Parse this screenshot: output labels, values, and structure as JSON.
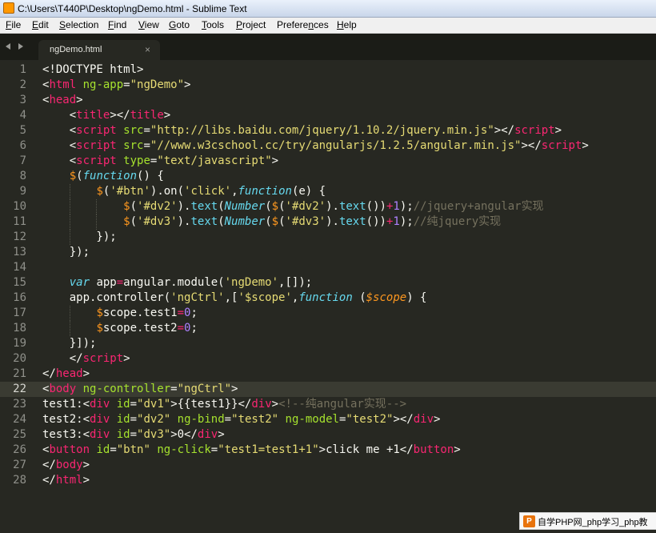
{
  "window": {
    "title": "C:\\Users\\T440P\\Desktop\\ngDemo.html - Sublime Text"
  },
  "menu": [
    {
      "acc": "F",
      "rest": "ile"
    },
    {
      "acc": "E",
      "rest": "dit"
    },
    {
      "acc": "S",
      "rest": "election"
    },
    {
      "acc": "F",
      "rest": "ind"
    },
    {
      "acc": "V",
      "rest": "iew"
    },
    {
      "acc": "G",
      "rest": "oto"
    },
    {
      "acc": "T",
      "rest": "ools"
    },
    {
      "acc": "P",
      "rest": "roject"
    },
    {
      "pre": "Prefere",
      "acc": "n",
      "rest": "ces"
    },
    {
      "acc": "H",
      "rest": "elp"
    }
  ],
  "tab": {
    "label": "ngDemo.html",
    "close": "×"
  },
  "editor": {
    "current_line": 22
  },
  "code_lines": [
    [
      [
        "p",
        "<!DOCTYPE html>"
      ]
    ],
    [
      [
        "p",
        "<"
      ],
      [
        "t",
        "html"
      ],
      [
        "p",
        " "
      ],
      [
        "a",
        "ng-app"
      ],
      [
        "p",
        "="
      ],
      [
        "s",
        "\"ngDemo\""
      ],
      [
        "p",
        ">"
      ]
    ],
    [
      [
        "p",
        "<"
      ],
      [
        "t",
        "head"
      ],
      [
        "p",
        ">"
      ]
    ],
    [
      [
        "p",
        "    <"
      ],
      [
        "t",
        "title"
      ],
      [
        "p",
        "></"
      ],
      [
        "t",
        "title"
      ],
      [
        "p",
        ">"
      ]
    ],
    [
      [
        "p",
        "    <"
      ],
      [
        "t",
        "script"
      ],
      [
        "p",
        " "
      ],
      [
        "a",
        "src"
      ],
      [
        "p",
        "="
      ],
      [
        "s",
        "\"http://libs.baidu.com/jquery/1.10.2/jquery.min.js\""
      ],
      [
        "p",
        "></"
      ],
      [
        "t",
        "script"
      ],
      [
        "p",
        ">"
      ]
    ],
    [
      [
        "p",
        "    <"
      ],
      [
        "t",
        "script"
      ],
      [
        "p",
        " "
      ],
      [
        "a",
        "src"
      ],
      [
        "p",
        "="
      ],
      [
        "s",
        "\"//www.w3cschool.cc/try/angularjs/1.2.5/angular.min.js\""
      ],
      [
        "p",
        "></"
      ],
      [
        "t",
        "script"
      ],
      [
        "p",
        ">"
      ]
    ],
    [
      [
        "p",
        "    <"
      ],
      [
        "t",
        "script"
      ],
      [
        "p",
        " "
      ],
      [
        "a",
        "type"
      ],
      [
        "p",
        "="
      ],
      [
        "s",
        "\"text/javascript\""
      ],
      [
        "p",
        ">"
      ]
    ],
    [
      [
        "p",
        "    "
      ],
      [
        "f",
        "$"
      ],
      [
        "p",
        "("
      ],
      [
        "k",
        "function"
      ],
      [
        "p",
        "() {"
      ]
    ],
    [
      [
        "p",
        "        "
      ],
      [
        "f",
        "$"
      ],
      [
        "p",
        "("
      ],
      [
        "s",
        "'#btn'"
      ],
      [
        "p",
        ").on("
      ],
      [
        "s",
        "'click'"
      ],
      [
        "p",
        ","
      ],
      [
        "k",
        "function"
      ],
      [
        "p",
        "(e) {"
      ]
    ],
    [
      [
        "p",
        "            "
      ],
      [
        "f",
        "$"
      ],
      [
        "p",
        "("
      ],
      [
        "s",
        "'#dv2'"
      ],
      [
        "p",
        ")."
      ],
      [
        "b",
        "text"
      ],
      [
        "p",
        "("
      ],
      [
        "k",
        "Number"
      ],
      [
        "p",
        "("
      ],
      [
        "f",
        "$"
      ],
      [
        "p",
        "("
      ],
      [
        "s",
        "'#dv2'"
      ],
      [
        "p",
        ")."
      ],
      [
        "b",
        "text"
      ],
      [
        "p",
        "())"
      ],
      [
        "o",
        "+"
      ],
      [
        "n",
        "1"
      ],
      [
        "p",
        ");"
      ],
      [
        "c",
        "//jquery+angular实现"
      ]
    ],
    [
      [
        "p",
        "            "
      ],
      [
        "f",
        "$"
      ],
      [
        "p",
        "("
      ],
      [
        "s",
        "'#dv3'"
      ],
      [
        "p",
        ")."
      ],
      [
        "b",
        "text"
      ],
      [
        "p",
        "("
      ],
      [
        "k",
        "Number"
      ],
      [
        "p",
        "("
      ],
      [
        "f",
        "$"
      ],
      [
        "p",
        "("
      ],
      [
        "s",
        "'#dv3'"
      ],
      [
        "p",
        ")."
      ],
      [
        "b",
        "text"
      ],
      [
        "p",
        "())"
      ],
      [
        "o",
        "+"
      ],
      [
        "n",
        "1"
      ],
      [
        "p",
        ");"
      ],
      [
        "c",
        "//纯jquery实现"
      ]
    ],
    [
      [
        "p",
        "        });"
      ]
    ],
    [
      [
        "p",
        "    });"
      ]
    ],
    [
      [
        "p",
        ""
      ]
    ],
    [
      [
        "p",
        "    "
      ],
      [
        "k",
        "var"
      ],
      [
        "p",
        " app"
      ],
      [
        "o",
        "="
      ],
      [
        "p",
        "angular.module("
      ],
      [
        "s",
        "'ngDemo'"
      ],
      [
        "p",
        ",[]);"
      ]
    ],
    [
      [
        "p",
        "    app.controller("
      ],
      [
        "s",
        "'ngCtrl'"
      ],
      [
        "p",
        ",["
      ],
      [
        "s",
        "'$scope'"
      ],
      [
        "p",
        ","
      ],
      [
        "k",
        "function"
      ],
      [
        "p",
        " ("
      ],
      [
        "v",
        "$scope"
      ],
      [
        "p",
        ") {"
      ]
    ],
    [
      [
        "p",
        "        "
      ],
      [
        "f",
        "$"
      ],
      [
        "p",
        "scope.test1"
      ],
      [
        "o",
        "="
      ],
      [
        "n",
        "0"
      ],
      [
        "p",
        ";"
      ]
    ],
    [
      [
        "p",
        "        "
      ],
      [
        "f",
        "$"
      ],
      [
        "p",
        "scope.test2"
      ],
      [
        "o",
        "="
      ],
      [
        "n",
        "0"
      ],
      [
        "p",
        ";"
      ]
    ],
    [
      [
        "p",
        "    }]);"
      ]
    ],
    [
      [
        "p",
        "    </"
      ],
      [
        "t",
        "script"
      ],
      [
        "p",
        ">"
      ]
    ],
    [
      [
        "p",
        "</"
      ],
      [
        "t",
        "head"
      ],
      [
        "p",
        ">"
      ]
    ],
    [
      [
        "p",
        "<"
      ],
      [
        "t",
        "body"
      ],
      [
        "p",
        " "
      ],
      [
        "a",
        "ng-controller"
      ],
      [
        "p",
        "="
      ],
      [
        "s",
        "\"ngCtrl\""
      ],
      [
        "p",
        ">"
      ]
    ],
    [
      [
        "p",
        "test1:<"
      ],
      [
        "t",
        "div"
      ],
      [
        "p",
        " "
      ],
      [
        "a",
        "id"
      ],
      [
        "p",
        "="
      ],
      [
        "s",
        "\"dv1\""
      ],
      [
        "p",
        ">{{test1}}</"
      ],
      [
        "t",
        "div"
      ],
      [
        "p",
        ">"
      ],
      [
        "c",
        "<!--纯angular实现-->"
      ]
    ],
    [
      [
        "p",
        "test2:<"
      ],
      [
        "t",
        "div"
      ],
      [
        "p",
        " "
      ],
      [
        "a",
        "id"
      ],
      [
        "p",
        "="
      ],
      [
        "s",
        "\"dv2\""
      ],
      [
        "p",
        " "
      ],
      [
        "a",
        "ng-bind"
      ],
      [
        "p",
        "="
      ],
      [
        "s",
        "\"test2\""
      ],
      [
        "p",
        " "
      ],
      [
        "a",
        "ng-model"
      ],
      [
        "p",
        "="
      ],
      [
        "s",
        "\"test2\""
      ],
      [
        "p",
        "></"
      ],
      [
        "t",
        "div"
      ],
      [
        "p",
        ">"
      ]
    ],
    [
      [
        "p",
        "test3:<"
      ],
      [
        "t",
        "div"
      ],
      [
        "p",
        " "
      ],
      [
        "a",
        "id"
      ],
      [
        "p",
        "="
      ],
      [
        "s",
        "\"dv3\""
      ],
      [
        "p",
        ">0</"
      ],
      [
        "t",
        "div"
      ],
      [
        "p",
        ">"
      ]
    ],
    [
      [
        "p",
        "<"
      ],
      [
        "t",
        "button"
      ],
      [
        "p",
        " "
      ],
      [
        "a",
        "id"
      ],
      [
        "p",
        "="
      ],
      [
        "s",
        "\"btn\""
      ],
      [
        "p",
        " "
      ],
      [
        "a",
        "ng-click"
      ],
      [
        "p",
        "="
      ],
      [
        "s",
        "\"test1=test1+1\""
      ],
      [
        "p",
        ">click me +1</"
      ],
      [
        "t",
        "button"
      ],
      [
        "p",
        ">"
      ]
    ],
    [
      [
        "p",
        "</"
      ],
      [
        "t",
        "body"
      ],
      [
        "p",
        ">"
      ]
    ],
    [
      [
        "p",
        "</"
      ],
      [
        "t",
        "html"
      ],
      [
        "p",
        ">"
      ]
    ]
  ],
  "syntax_colors": {
    "p": "#f8f8f2",
    "t": "#f92672",
    "a": "#a6e22e",
    "s": "#e6db74",
    "k": "#66d9ef",
    "f": "#fd971f",
    "b": "#66d9ef",
    "o": "#f92672",
    "n": "#ae81ff",
    "c": "#75715e",
    "v": "#fd971f"
  },
  "watermark": {
    "logo": "P",
    "text": "自学PHP网_php学习_php教"
  }
}
